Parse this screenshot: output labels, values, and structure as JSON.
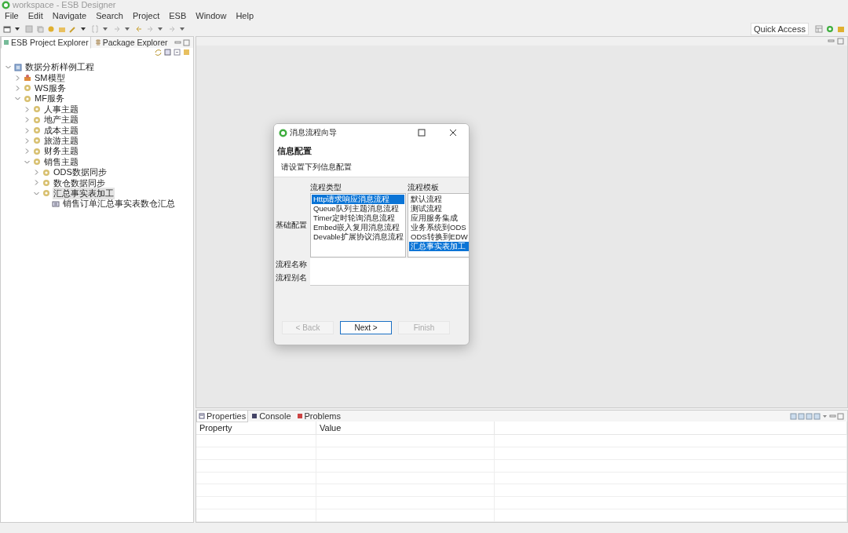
{
  "window": {
    "title": "workspace - ESB Designer"
  },
  "menu": [
    "File",
    "Edit",
    "Navigate",
    "Search",
    "Project",
    "ESB",
    "Window",
    "Help"
  ],
  "quick_access": {
    "label": "Quick Access"
  },
  "explorer": {
    "tabs": [
      {
        "label": "ESB Project Explorer",
        "selected": true
      },
      {
        "label": "Package Explorer",
        "selected": false
      }
    ],
    "tree": [
      {
        "label": "数据分析样例工程",
        "kind": "project",
        "expanded": true,
        "selected": false,
        "children": [
          {
            "label": "SM模型",
            "kind": "model",
            "expanded": false,
            "selected": false
          },
          {
            "label": "WS服务",
            "kind": "service",
            "expanded": false,
            "selected": false
          },
          {
            "label": "MF服务",
            "kind": "service",
            "expanded": true,
            "selected": false,
            "children": [
              {
                "label": "人事主题",
                "kind": "service",
                "expanded": false,
                "selected": false
              },
              {
                "label": "地产主题",
                "kind": "service",
                "expanded": false,
                "selected": false
              },
              {
                "label": "成本主题",
                "kind": "service",
                "expanded": false,
                "selected": false
              },
              {
                "label": "旅游主题",
                "kind": "service",
                "expanded": false,
                "selected": false
              },
              {
                "label": "财务主题",
                "kind": "service",
                "expanded": false,
                "selected": false
              },
              {
                "label": "销售主题",
                "kind": "service",
                "expanded": true,
                "selected": false,
                "children": [
                  {
                    "label": "ODS数据同步",
                    "kind": "service",
                    "expanded": false,
                    "selected": false
                  },
                  {
                    "label": "数仓数据同步",
                    "kind": "service",
                    "expanded": false,
                    "selected": false
                  },
                  {
                    "label": "汇总事实表加工",
                    "kind": "service",
                    "expanded": true,
                    "selected": true,
                    "children": [
                      {
                        "label": "销售订单汇总事实表数仓汇总",
                        "kind": "flow",
                        "selected": false
                      }
                    ]
                  }
                ]
              }
            ]
          }
        ]
      }
    ]
  },
  "dialog": {
    "title": "消息流程向导",
    "heading": "信息配置",
    "subtitle": "请设置下列信息配置",
    "section_label": "基础配置",
    "flow_type_label": "流程类型",
    "flow_types": [
      {
        "label": "Http请求响应消息流程",
        "selected": true
      },
      {
        "label": "Queue队列主题消息流程",
        "selected": false
      },
      {
        "label": "Timer定时轮询消息流程",
        "selected": false
      },
      {
        "label": "Embed嵌入复用消息流程",
        "selected": false
      },
      {
        "label": "Devable扩展协议消息流程",
        "selected": false
      }
    ],
    "template_label": "流程模板",
    "templates": [
      {
        "label": "默认流程",
        "selected": false
      },
      {
        "label": "测试流程",
        "selected": false
      },
      {
        "label": "应用服务集成",
        "selected": false
      },
      {
        "label": "业务系统到ODS",
        "selected": false
      },
      {
        "label": "ODS转换到EDW",
        "selected": false
      },
      {
        "label": "汇总事实表加工",
        "selected": true
      }
    ],
    "name_label": "流程名称",
    "alias_label": "流程别名",
    "buttons": [
      {
        "label": "< Back",
        "disabled": true
      },
      {
        "label": "Next >",
        "disabled": false
      },
      {
        "label": "Finish",
        "disabled": true
      }
    ]
  },
  "bottom_panel": {
    "tabs": [
      {
        "label": "Properties",
        "selected": true
      },
      {
        "label": "Console",
        "selected": false
      },
      {
        "label": "Problems",
        "selected": false
      }
    ],
    "columns": [
      "Property",
      "Value"
    ]
  }
}
